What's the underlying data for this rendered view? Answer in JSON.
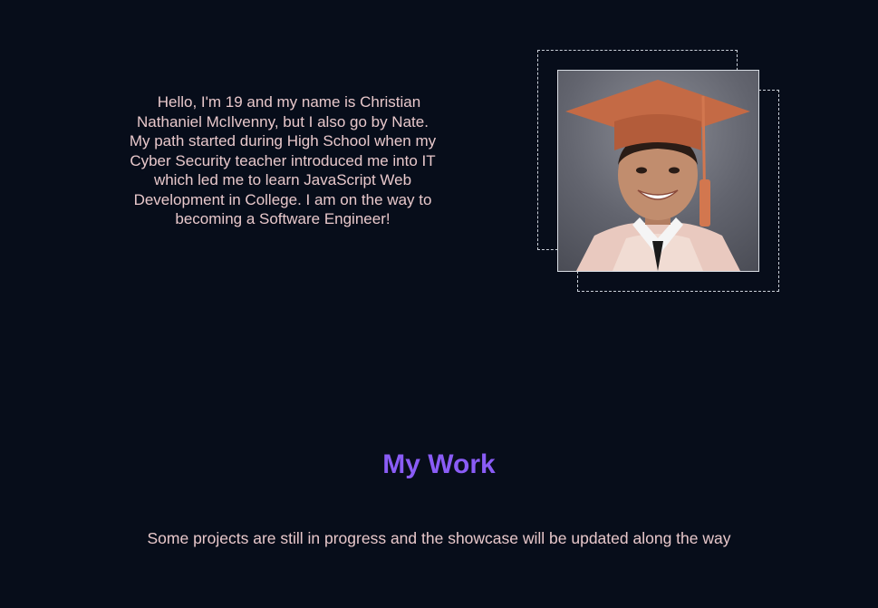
{
  "about": {
    "bio": "Hello, I'm 19 and my name is Christian Nathaniel McIlvenny, but I also go by Nate. My path started during High School when my Cyber Security teacher introduced me into IT which led me to learn JavaScript Web Development in College. I am on the way to becoming a Software Engineer!"
  },
  "work": {
    "title": "My Work",
    "subtitle": "Some projects are still in progress and the showcase will be updated along the way"
  },
  "colors": {
    "background": "#070d1a",
    "text": "#e8c8cb",
    "accent": "#8a5cf6"
  }
}
